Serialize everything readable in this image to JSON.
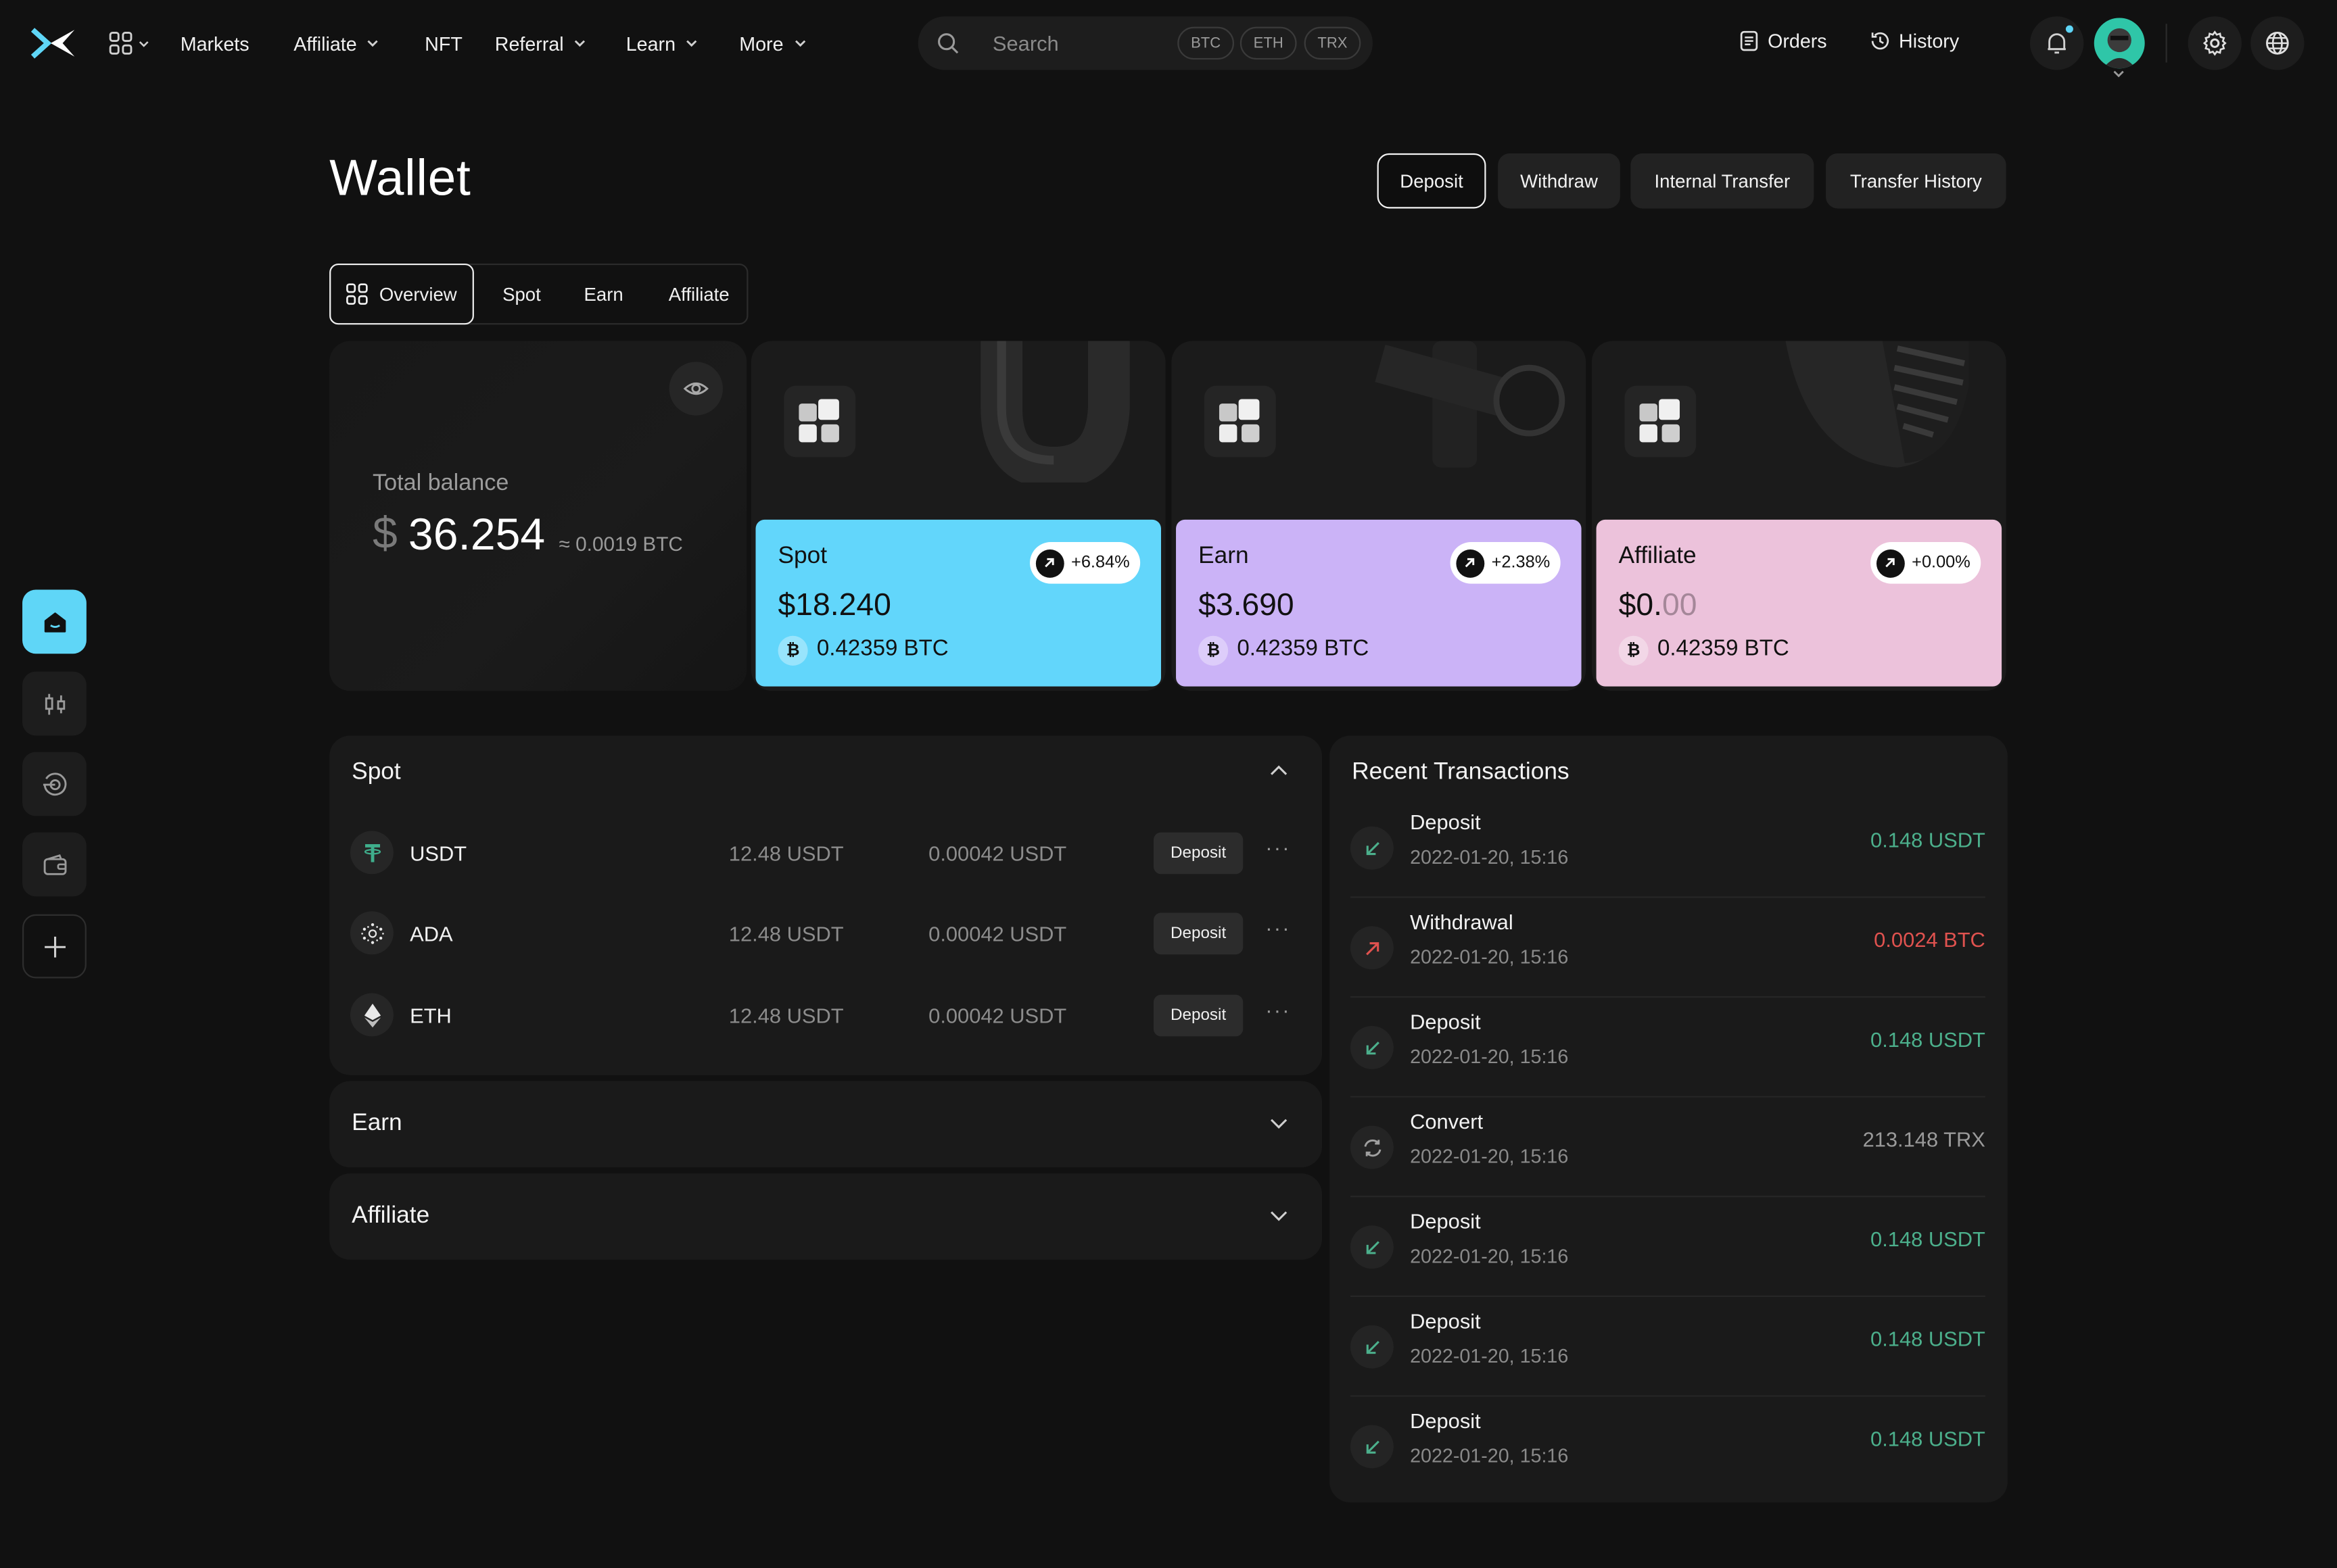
{
  "colors": {
    "accent_cyan": "#5fd6f7",
    "spot_card": "#62d6fb",
    "earn_card": "#cbb3f7",
    "affiliate_card": "#ecc2db",
    "positive": "#4cb08c",
    "negative": "#e0524f",
    "neutral": "#9a9a9a"
  },
  "nav": {
    "menu_items": [
      "Markets",
      "Affiliate",
      "NFT",
      "Referral",
      "Learn",
      "More"
    ],
    "search_placeholder": "Search",
    "search_tags": [
      "BTC",
      "ETH",
      "TRX"
    ],
    "orders_label": "Orders",
    "history_label": "History"
  },
  "header": {
    "title": "Wallet",
    "buttons": [
      "Deposit",
      "Withdraw",
      "Internal Transfer",
      "Transfer History"
    ]
  },
  "tabs": [
    "Overview",
    "Spot",
    "Earn",
    "Affiliate"
  ],
  "sidebar": {
    "icons": [
      "wallet-home-icon",
      "trading-candles-icon",
      "earn-target-icon",
      "wallet-icon",
      "add-icon"
    ]
  },
  "total_balance": {
    "label": "Total balance",
    "currency_symbol": "$",
    "amount": "36.254",
    "btc_equivalent": "≈ 0.0019 BTC"
  },
  "accounts": [
    {
      "name": "Spot",
      "usd": "$18.240",
      "usd_dim": "",
      "btc": "0.42359 BTC",
      "change": "+6.84%"
    },
    {
      "name": "Earn",
      "usd": "$3.690",
      "usd_dim": "",
      "btc": "0.42359 BTC",
      "change": "+2.38%"
    },
    {
      "name": "Affiliate",
      "usd": "$0.",
      "usd_dim": "00",
      "btc": "0.42359 BTC",
      "change": "+0.00%"
    }
  ],
  "spot_panel": {
    "title": "Spot",
    "coins": [
      {
        "name": "USDT",
        "value": "12.48 USDT",
        "value2": "0.00042 USDT",
        "action": "Deposit"
      },
      {
        "name": "ADA",
        "value": "12.48 USDT",
        "value2": "0.00042 USDT",
        "action": "Deposit"
      },
      {
        "name": "ETH",
        "value": "12.48 USDT",
        "value2": "0.00042 USDT",
        "action": "Deposit"
      }
    ]
  },
  "earn_panel": {
    "title": "Earn"
  },
  "affiliate_panel": {
    "title": "Affiliate"
  },
  "transactions": {
    "title": "Recent Transactions",
    "items": [
      {
        "type": "Deposit",
        "date": "2022-01-20, 15:16",
        "amount": "0.148 USDT",
        "kind": "in"
      },
      {
        "type": "Withdrawal",
        "date": "2022-01-20, 15:16",
        "amount": "0.0024 BTC",
        "kind": "out"
      },
      {
        "type": "Deposit",
        "date": "2022-01-20, 15:16",
        "amount": "0.148 USDT",
        "kind": "in"
      },
      {
        "type": "Convert",
        "date": "2022-01-20, 15:16",
        "amount": "213.148 TRX",
        "kind": "convert"
      },
      {
        "type": "Deposit",
        "date": "2022-01-20, 15:16",
        "amount": "0.148 USDT",
        "kind": "in"
      },
      {
        "type": "Deposit",
        "date": "2022-01-20, 15:16",
        "amount": "0.148 USDT",
        "kind": "in"
      },
      {
        "type": "Deposit",
        "date": "2022-01-20, 15:16",
        "amount": "0.148 USDT",
        "kind": "in"
      }
    ]
  }
}
